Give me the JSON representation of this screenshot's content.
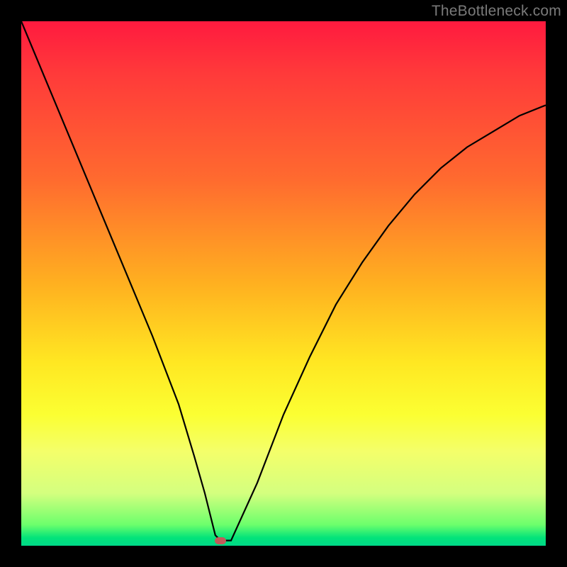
{
  "watermark": "TheBottleneck.com",
  "chart_data": {
    "type": "line",
    "title": "",
    "xlabel": "",
    "ylabel": "",
    "xlim": [
      0,
      100
    ],
    "ylim": [
      0,
      100
    ],
    "grid": false,
    "series": [
      {
        "name": "curve",
        "x": [
          0,
          5,
          10,
          15,
          20,
          25,
          30,
          33,
          35,
          36,
          37,
          38,
          40,
          45,
          50,
          55,
          60,
          65,
          70,
          75,
          80,
          85,
          90,
          95,
          100
        ],
        "y": [
          100,
          88,
          76,
          64,
          52,
          40,
          27,
          17,
          10,
          6,
          2,
          1,
          1,
          12,
          25,
          36,
          46,
          54,
          61,
          67,
          72,
          76,
          79,
          82,
          84
        ]
      }
    ],
    "marker": {
      "x": 38,
      "y": 1
    },
    "colors": {
      "gradient_top": "#ff1a3f",
      "gradient_mid": "#ffe722",
      "gradient_bottom": "#00d988",
      "curve": "#000000",
      "marker": "#c35a5a",
      "frame": "#000000"
    }
  }
}
